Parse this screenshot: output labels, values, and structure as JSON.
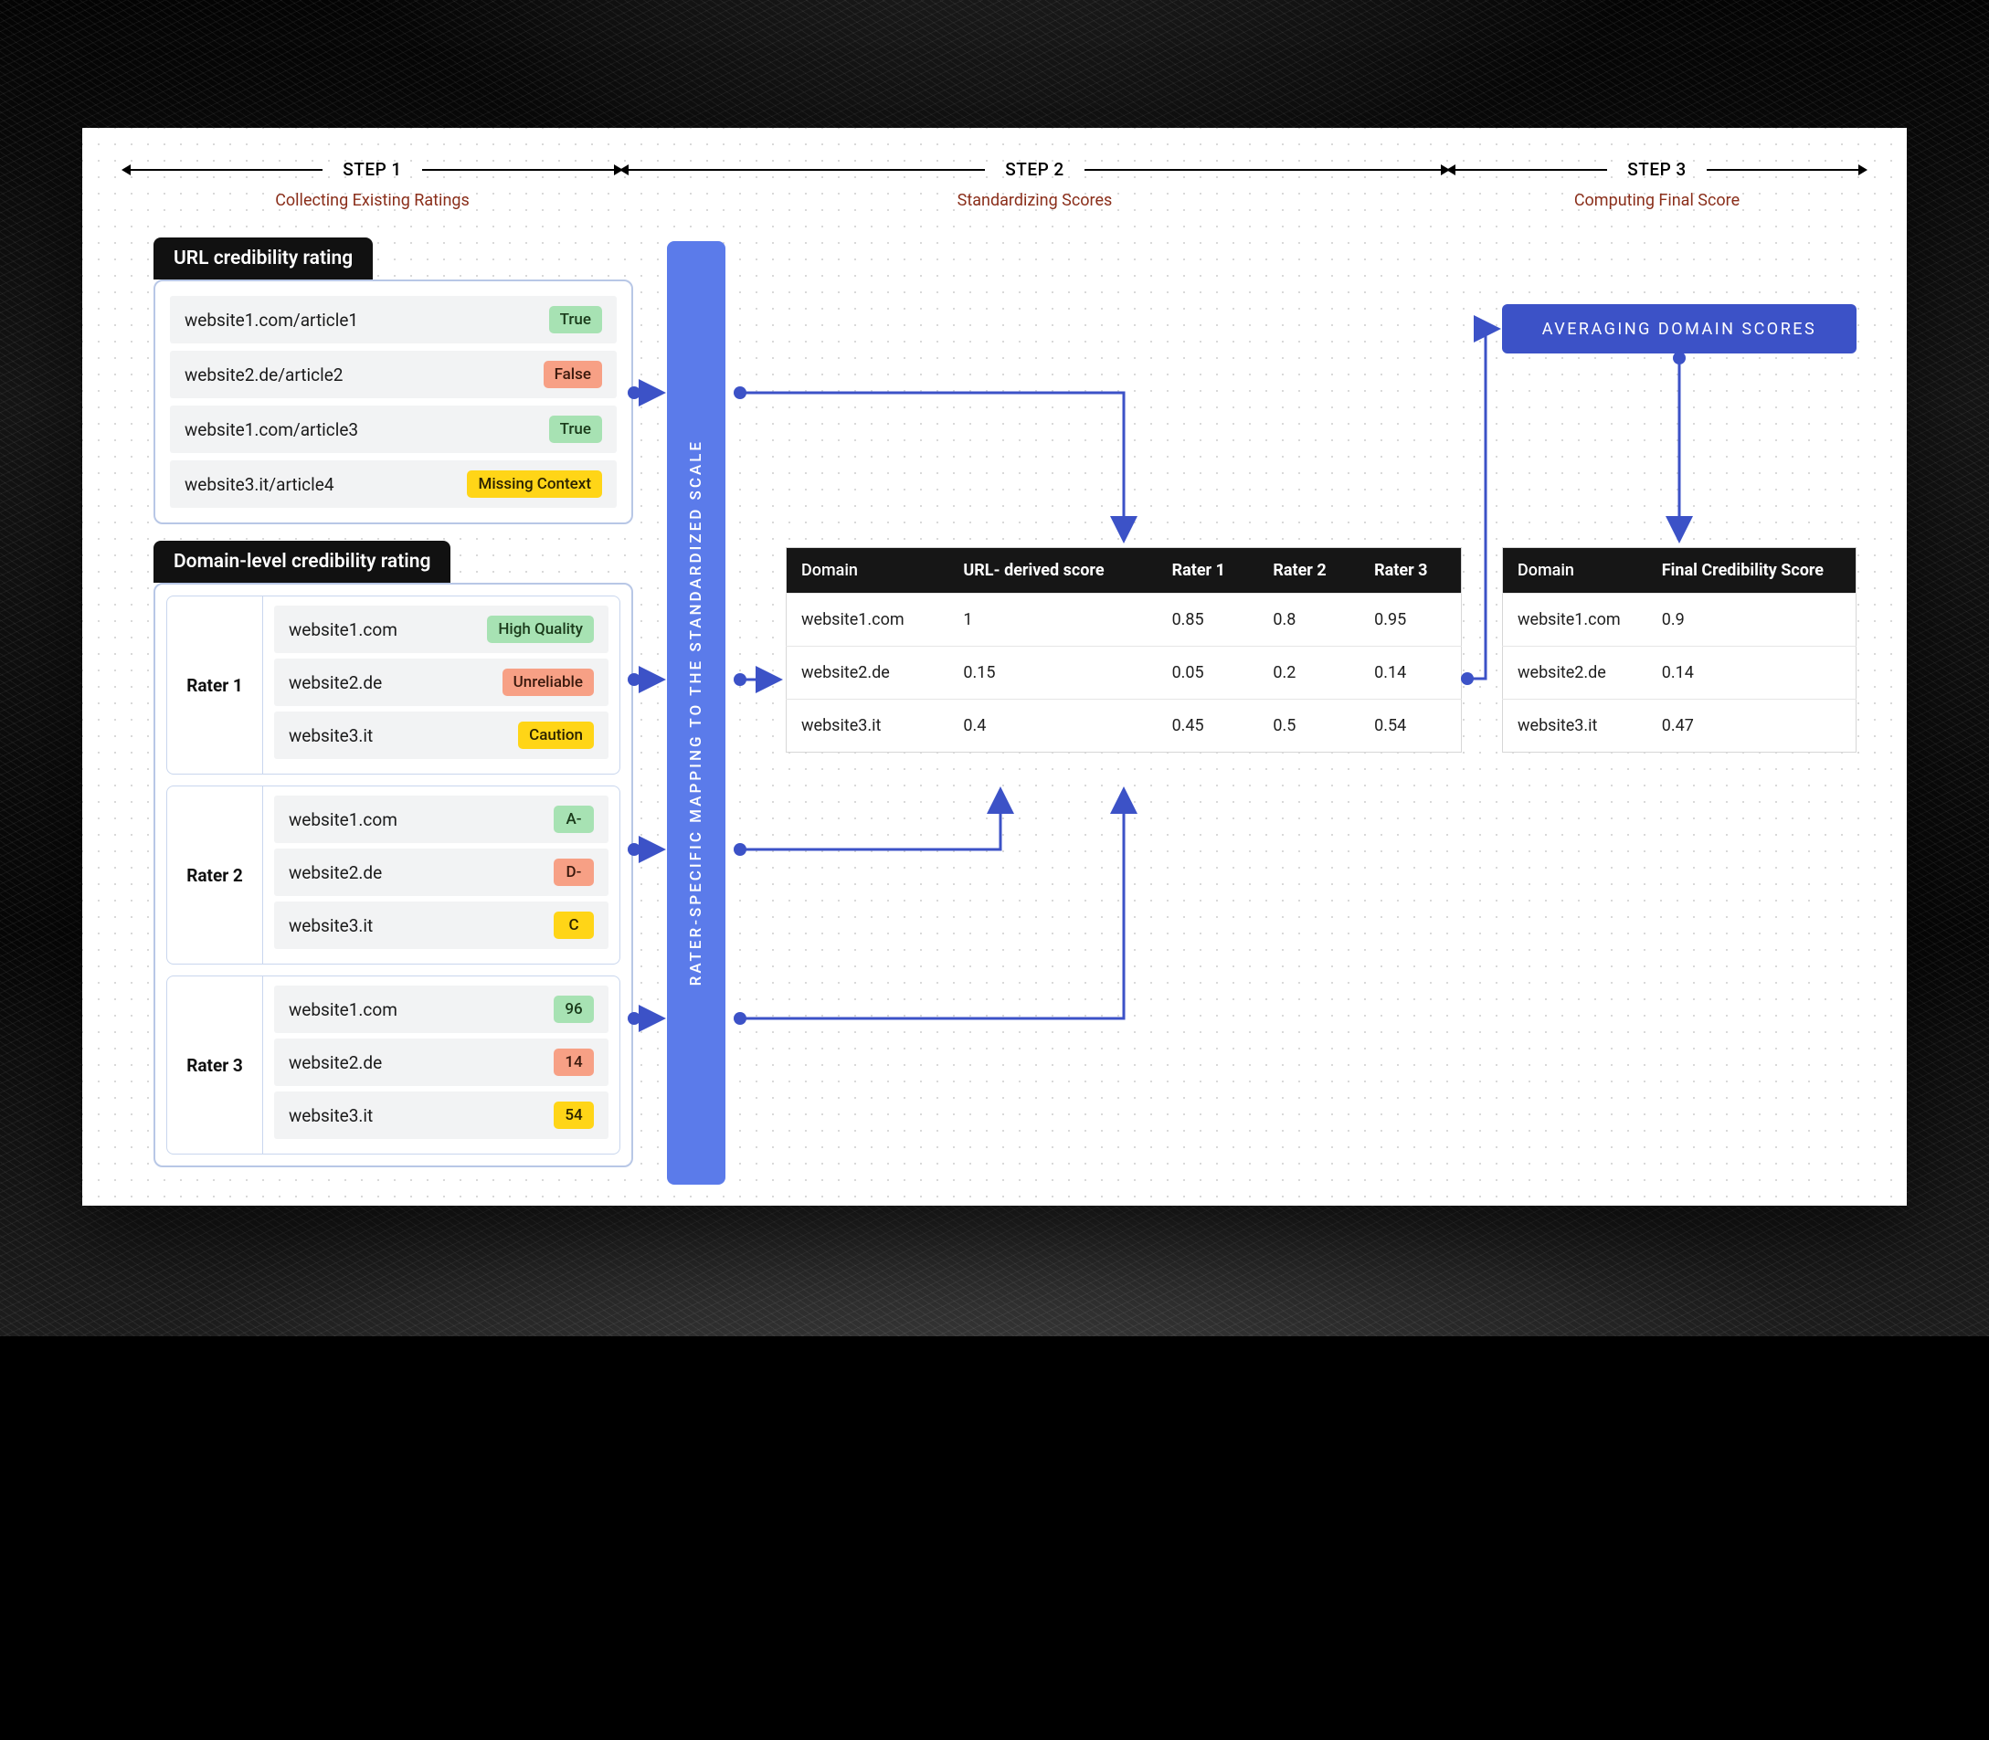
{
  "steps": [
    {
      "title": "STEP 1",
      "subtitle": "Collecting Existing Ratings"
    },
    {
      "title": "STEP 2",
      "subtitle": "Standardizing Scores"
    },
    {
      "title": "STEP 3",
      "subtitle": "Computing Final Score"
    }
  ],
  "url_block": {
    "title": "URL credibility rating",
    "rows": [
      {
        "url": "website1.com/article1",
        "label": "True",
        "cls": "b-green"
      },
      {
        "url": "website2.de/article2",
        "label": "False",
        "cls": "b-red"
      },
      {
        "url": "website1.com/article3",
        "label": "True",
        "cls": "b-green"
      },
      {
        "url": "website3.it/article4",
        "label": "Missing Context",
        "cls": "b-yellow"
      }
    ]
  },
  "domain_block": {
    "title": "Domain-level credibility rating",
    "raters": [
      {
        "name": "Rater 1",
        "rows": [
          {
            "domain": "website1.com",
            "label": "High Quality",
            "cls": "b-green"
          },
          {
            "domain": "website2.de",
            "label": "Unreliable",
            "cls": "b-red"
          },
          {
            "domain": "website3.it",
            "label": "Caution",
            "cls": "b-yellow"
          }
        ]
      },
      {
        "name": "Rater 2",
        "rows": [
          {
            "domain": "website1.com",
            "label": "A-",
            "cls": "b-green"
          },
          {
            "domain": "website2.de",
            "label": "D-",
            "cls": "b-red"
          },
          {
            "domain": "website3.it",
            "label": "C",
            "cls": "b-yellow"
          }
        ]
      },
      {
        "name": "Rater 3",
        "rows": [
          {
            "domain": "website1.com",
            "label": "96",
            "cls": "b-green"
          },
          {
            "domain": "website2.de",
            "label": "14",
            "cls": "b-red"
          },
          {
            "domain": "website3.it",
            "label": "54",
            "cls": "b-yellow"
          }
        ]
      }
    ]
  },
  "map_bar": "RATER-SPECIFIC MAPPING TO THE STANDARDIZED SCALE",
  "table2": {
    "headers": [
      "Domain",
      "URL- derived score",
      "Rater 1",
      "Rater 2",
      "Rater 3"
    ],
    "rows": [
      [
        "website1.com",
        "1",
        "0.85",
        "0.8",
        "0.95"
      ],
      [
        "website2.de",
        "0.15",
        "0.05",
        "0.2",
        "0.14"
      ],
      [
        "website3.it",
        "0.4",
        "0.45",
        "0.5",
        "0.54"
      ]
    ]
  },
  "avg_bar": "AVERAGING DOMAIN SCORES",
  "table3": {
    "headers": [
      "Domain",
      "Final Credibility Score"
    ],
    "rows": [
      [
        "website1.com",
        "0.9"
      ],
      [
        "website2.de",
        "0.14"
      ],
      [
        "website3.it",
        "0.47"
      ]
    ]
  }
}
